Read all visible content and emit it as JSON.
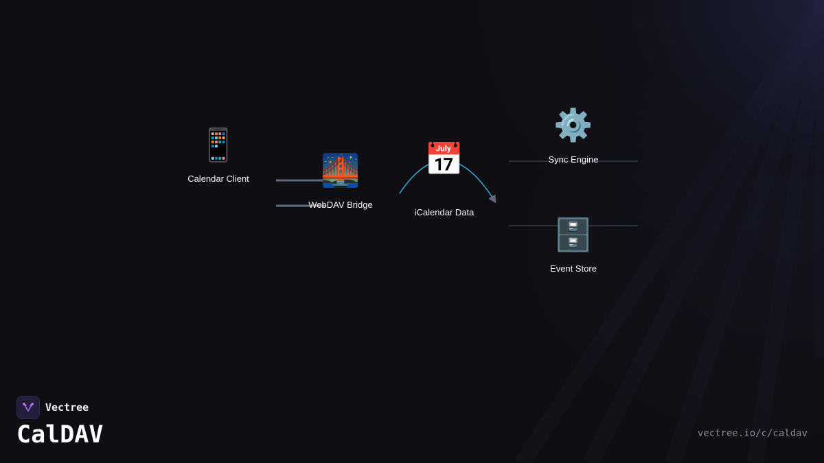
{
  "nodes": [
    {
      "id": "client",
      "label": "Calendar Client",
      "icon": "mobile-phone-icon",
      "glyph": "📱"
    },
    {
      "id": "bridge",
      "label": "WebDAV Bridge",
      "icon": "bridge-at-night-icon",
      "glyph": "🌉"
    },
    {
      "id": "ical",
      "label": "iCalendar Data",
      "icon": "calendar-icon",
      "glyph": "📅"
    },
    {
      "id": "sync",
      "label": "Sync Engine",
      "icon": "gear-icon",
      "glyph": "⚙️"
    },
    {
      "id": "store",
      "label": "Event Store",
      "icon": "file-cabinet-icon",
      "glyph": "🗄️"
    }
  ],
  "edges": [
    {
      "from": "client",
      "to": "bridge",
      "style": "thick-gray"
    },
    {
      "from": "bridge",
      "to": "sync",
      "style": "curved-arrow",
      "color": "#3aa6e0"
    }
  ],
  "colors": {
    "background": "#0f0f13",
    "accent": "#3aa6e0",
    "edge": "#5f6b7d",
    "rule": "#4a5263",
    "logo": "#221f3d"
  },
  "brand": {
    "name": "Vectree",
    "icon": "vectree-logo-icon"
  },
  "title": "CalDAV",
  "url": "vectree.io/c/caldav"
}
